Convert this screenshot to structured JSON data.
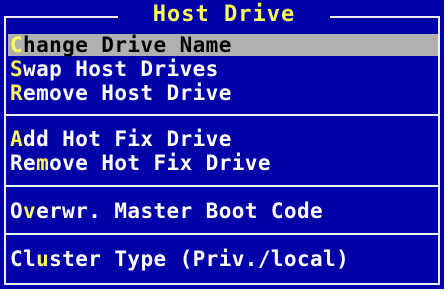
{
  "menu": {
    "title": "Host Drive",
    "items": [
      {
        "hotkey": "C",
        "rest": "hange Drive Name",
        "selected": true
      },
      {
        "hotkey": "S",
        "rest": "wap Host Drives",
        "selected": false
      },
      {
        "hotkey": "R",
        "rest": "emove Host Drive",
        "selected": false
      },
      {
        "hotkey": "A",
        "rest": "dd Hot Fix Drive",
        "selected": false
      },
      {
        "pre": "Re",
        "hotkey": "m",
        "rest": "ove Hot Fix Drive",
        "selected": false
      },
      {
        "pre": "O",
        "hotkey": "v",
        "rest": "erwr. Master Boot Code",
        "selected": false
      },
      {
        "pre": "Cl",
        "hotkey": "u",
        "rest": "ster Type (Priv./local)",
        "selected": false
      }
    ]
  },
  "colors": {
    "background": "#0000a8",
    "text": "#ffffff",
    "hotkey": "#ffff54",
    "selection": "#b0b0b0",
    "border": "#f0f0f0"
  }
}
